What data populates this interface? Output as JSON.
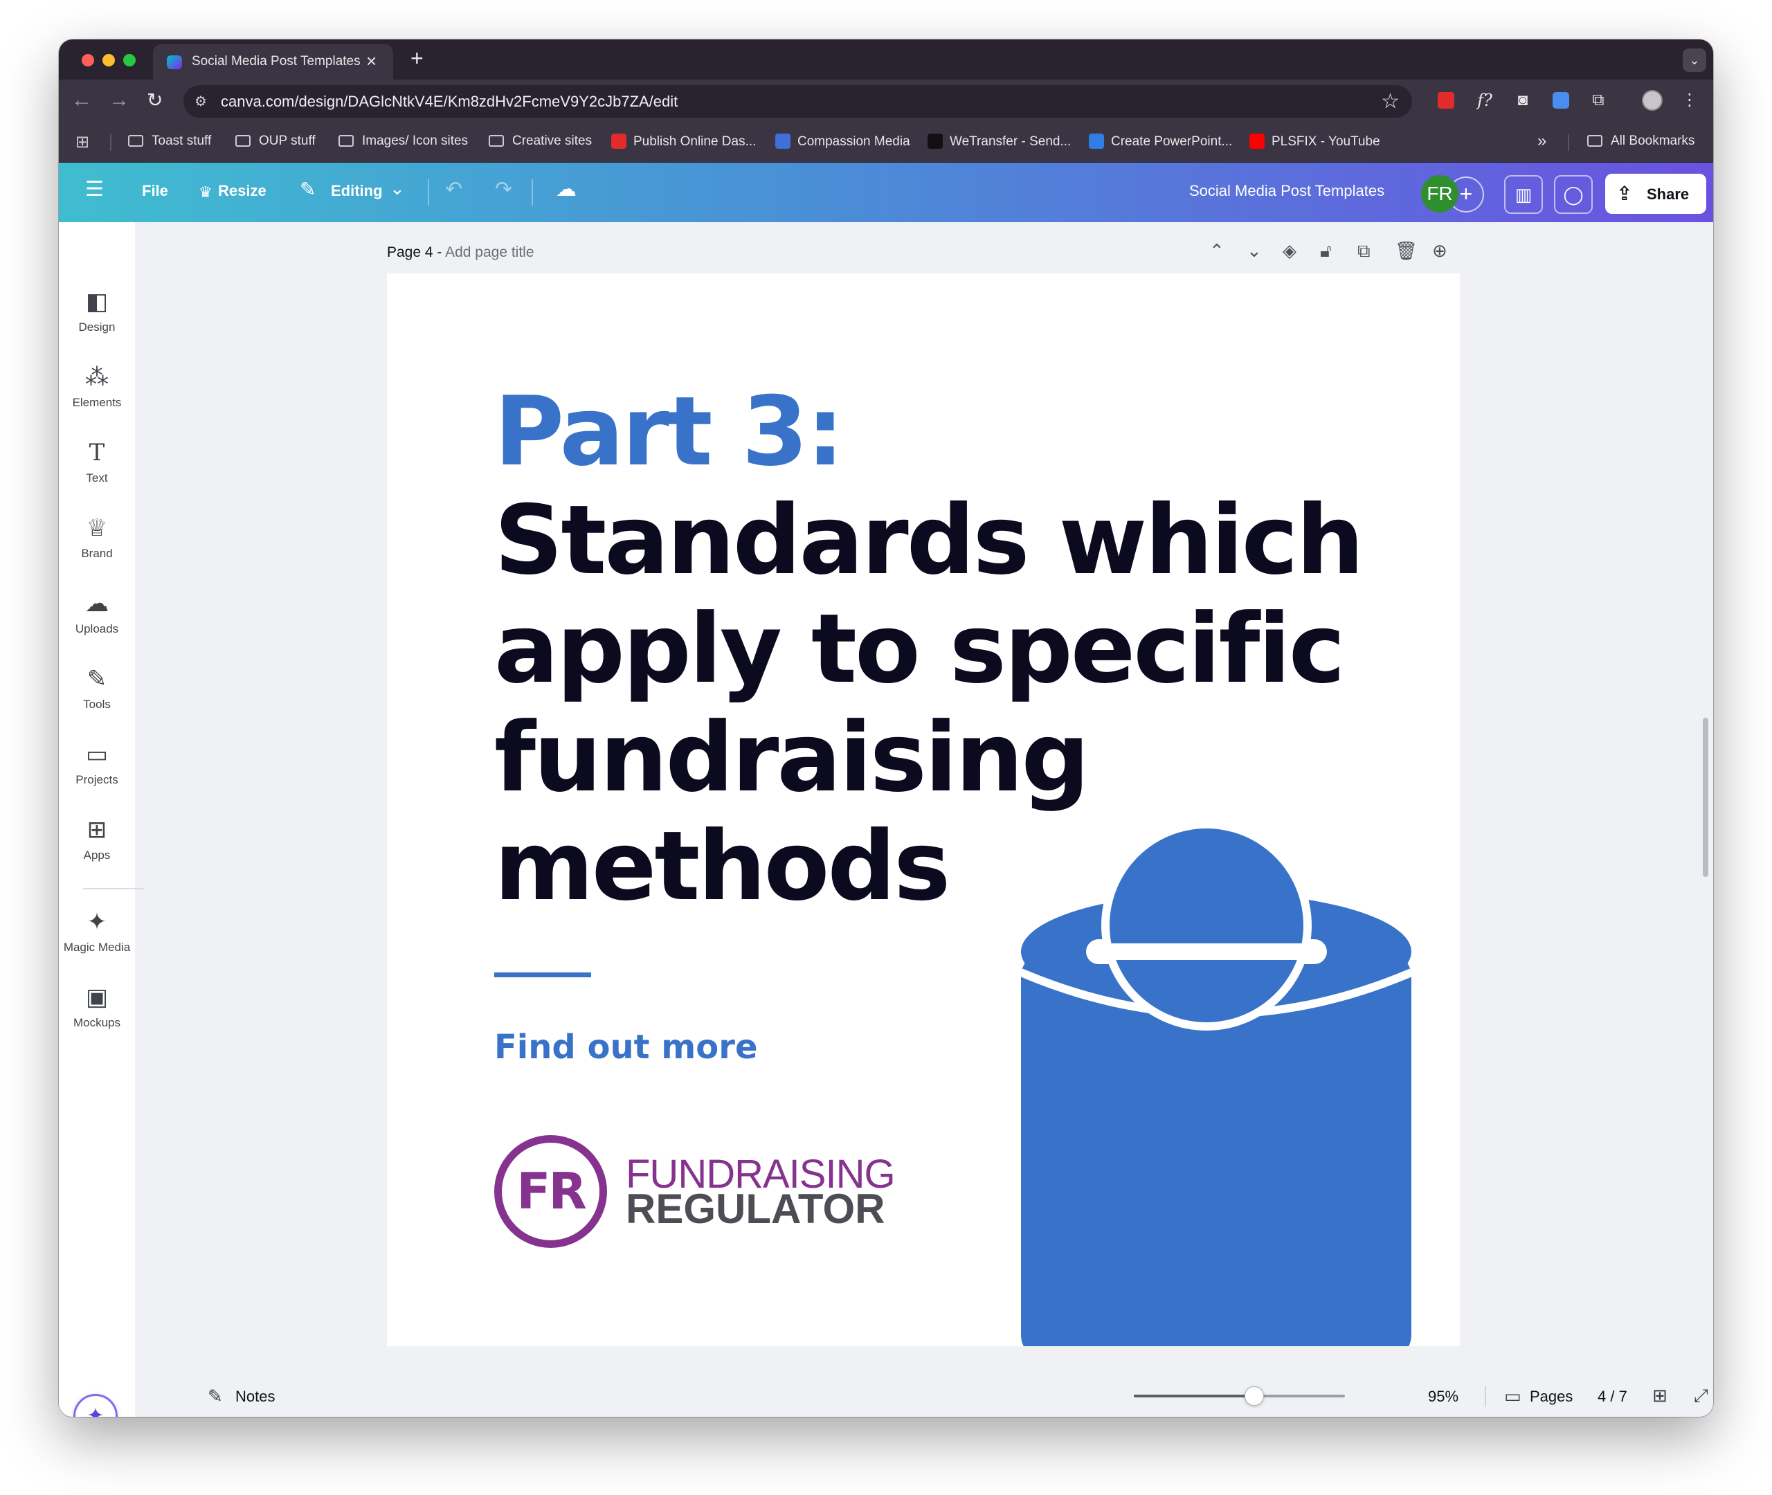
{
  "browser": {
    "tab_title": "Social Media Post Templates",
    "tab_close_icon": "×",
    "new_tab_icon": "+",
    "url": "canva.com/design/DAGlcNtkV4E/Km8zdHv2FcmeV9Y2cJb7ZA/edit",
    "bookmarks": [
      {
        "label": "Toast stuff",
        "icon": "folder-icon"
      },
      {
        "label": "OUP stuff",
        "icon": "folder-icon"
      },
      {
        "label": "Images/ Icon sites",
        "icon": "folder-icon"
      },
      {
        "label": "Creative sites",
        "icon": "folder-icon"
      },
      {
        "label": "Publish Online Das...",
        "icon": "adobe-icon",
        "color": "#e22b2b"
      },
      {
        "label": "Compassion Media",
        "icon": "site-icon",
        "color": "#3f6fd8"
      },
      {
        "label": "WeTransfer - Send...",
        "icon": "wetransfer-icon",
        "color": "#111111"
      },
      {
        "label": "Create PowerPoint...",
        "icon": "powerpoint-icon",
        "color": "#2f7ee6"
      },
      {
        "label": "PLSFIX - YouTube",
        "icon": "youtube-icon",
        "color": "#ff0000"
      }
    ],
    "all_bookmarks": "All Bookmarks"
  },
  "canva_header": {
    "file": "File",
    "resize": "Resize",
    "editing": "Editing",
    "design_title": "Social Media Post Templates",
    "avatar_initials": "FR",
    "share": "Share",
    "brand_gradient": [
      "#3fbdd0",
      "#6a52e0"
    ]
  },
  "sidebar": {
    "items": [
      {
        "label": "Design",
        "icon": "design-icon"
      },
      {
        "label": "Elements",
        "icon": "elements-icon"
      },
      {
        "label": "Text",
        "icon": "text-icon"
      },
      {
        "label": "Brand",
        "icon": "brand-icon"
      },
      {
        "label": "Uploads",
        "icon": "uploads-icon"
      },
      {
        "label": "Tools",
        "icon": "tools-icon"
      },
      {
        "label": "Projects",
        "icon": "projects-icon"
      },
      {
        "label": "Apps",
        "icon": "apps-icon"
      },
      {
        "label": "Magic Media",
        "icon": "magic-media-icon"
      },
      {
        "label": "Mockups",
        "icon": "mockups-icon"
      }
    ]
  },
  "page_header": {
    "page_label": "Page 4 -",
    "title_placeholder": "Add page title"
  },
  "design": {
    "headline_accent": "Part 3:",
    "headline_rest": "Standards which apply to specific fundraising methods",
    "cta": "Find out more",
    "logo_mark": "FR",
    "logo_line1": "FUNDRAISING",
    "logo_line2": "REGULATOR",
    "accent_color": "#3873c9",
    "logo_color": "#85338e",
    "text_color": "#0c0a1e"
  },
  "bottombar": {
    "notes": "Notes",
    "zoom_percent": 95,
    "zoom_label": "95%",
    "zoom_fraction": 0.57,
    "pages": "Pages",
    "page_count": "4 / 7"
  }
}
